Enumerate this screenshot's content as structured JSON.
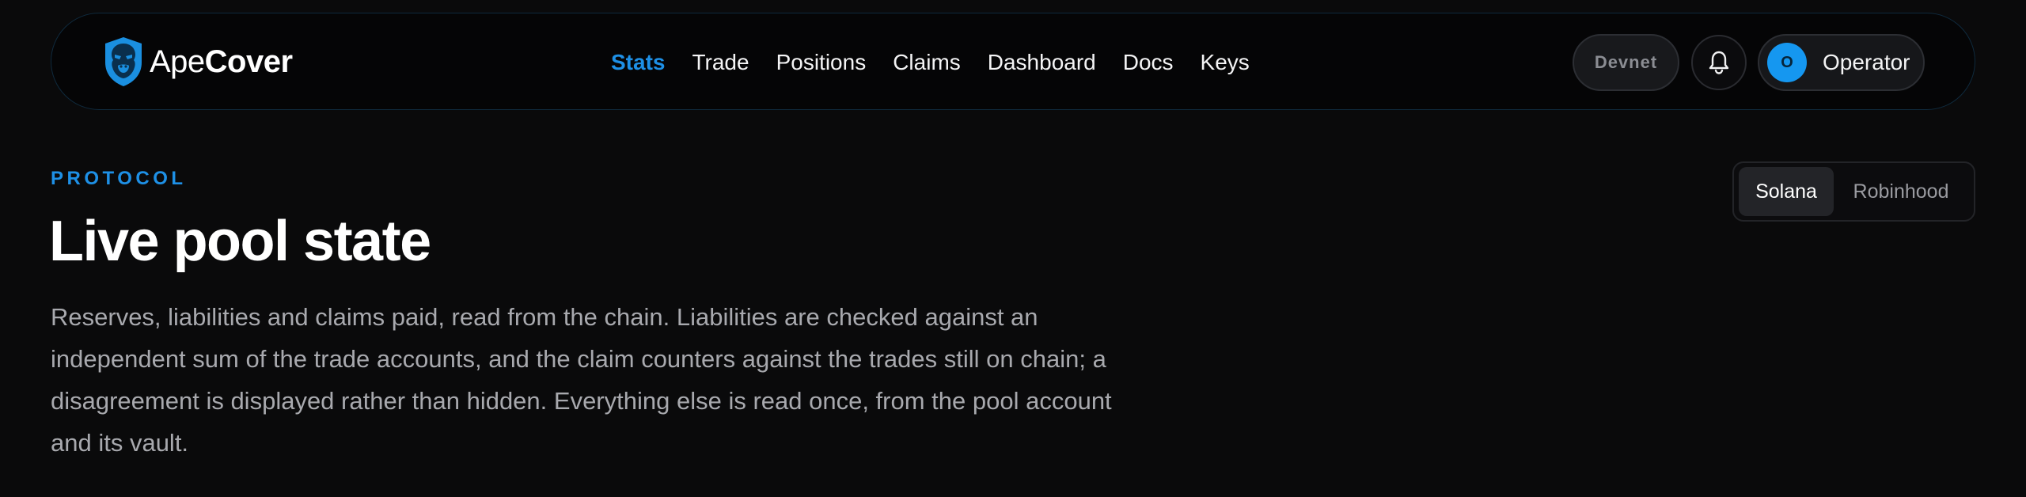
{
  "brand": {
    "name_light": "Ape",
    "name_bold": "Cover",
    "logo_icon": "gorilla-shield-icon",
    "accent": "#1e90e6"
  },
  "nav": {
    "links": [
      {
        "label": "Stats",
        "active": true
      },
      {
        "label": "Trade"
      },
      {
        "label": "Positions"
      },
      {
        "label": "Claims"
      },
      {
        "label": "Dashboard"
      },
      {
        "label": "Docs"
      },
      {
        "label": "Keys"
      }
    ]
  },
  "header_actions": {
    "network_label": "Devnet",
    "bell_icon": "bell-icon",
    "avatar_initial": "O",
    "user_label": "Operator"
  },
  "page": {
    "eyebrow": "PROTOCOL",
    "title": "Live pool state",
    "description": "Reserves, liabilities and claims paid, read from the chain. Liabilities are checked against an independent sum of the trade accounts, and the claim counters against the trades still on chain; a disagreement is displayed rather than hidden. Everything else is read once, from the pool account and its vault."
  },
  "chain_toggle": {
    "options": [
      "Solana",
      "Robinhood"
    ],
    "selected": "Solana"
  }
}
